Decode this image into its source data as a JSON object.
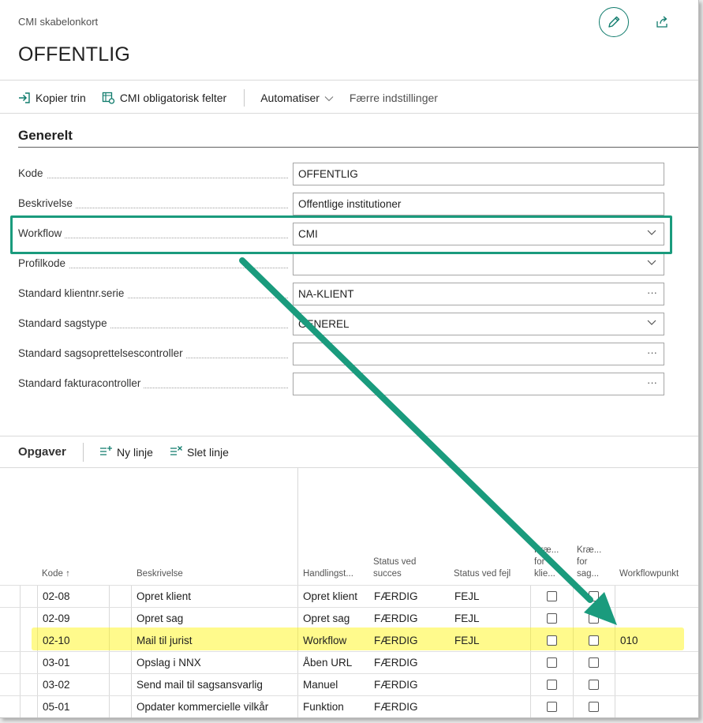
{
  "header": {
    "breadcrumb": "CMI skabelonkort",
    "title": "OFFENTLIG"
  },
  "actions": {
    "kopier": "Kopier trin",
    "obligatorisk": "CMI obligatorisk felter",
    "automatiser": "Automatiser",
    "faerre": "Færre indstillinger"
  },
  "general": {
    "title": "Generelt",
    "fields": [
      {
        "label": "Kode",
        "value": "OFFENTLIG",
        "suffix": ""
      },
      {
        "label": "Beskrivelse",
        "value": "Offentlige institutioner",
        "suffix": ""
      },
      {
        "label": "Workflow",
        "value": "CMI",
        "suffix": "chevron"
      },
      {
        "label": "Profilkode",
        "value": "",
        "suffix": "chevron"
      },
      {
        "label": "Standard klientnr.serie",
        "value": "NA-KLIENT",
        "suffix": "dots"
      },
      {
        "label": "Standard sagstype",
        "value": "GENEREL",
        "suffix": "chevron"
      },
      {
        "label": "Standard sagsoprettelsescontroller",
        "value": "",
        "suffix": "dots"
      },
      {
        "label": "Standard fakturacontroller",
        "value": "",
        "suffix": "dots"
      }
    ]
  },
  "tasks": {
    "title": "Opgaver",
    "new_line": "Ny linje",
    "delete_line": "Slet linje",
    "columns": {
      "kode": "Kode",
      "sort_indicator": "↑",
      "beskrivelse": "Beskrivelse",
      "handling": "Handlingst...",
      "status_succes_1": "Status ved",
      "status_succes_2": "succes",
      "status_fejl": "Status ved fejl",
      "kraev_klient_1": "Kræ...",
      "kraev_klient_2": "for",
      "kraev_klient_3": "klie...",
      "kraev_sag_1": "Kræ...",
      "kraev_sag_2": "for",
      "kraev_sag_3": "sag...",
      "workflowpunkt": "Workflowpunkt"
    },
    "rows": [
      {
        "kode": "02-08",
        "beskrivelse": "Opret klient",
        "handling": "Opret klient",
        "succes": "FÆRDIG",
        "fejl": "FEJL",
        "workflowpunkt": ""
      },
      {
        "kode": "02-09",
        "beskrivelse": "Opret sag",
        "handling": "Opret sag",
        "succes": "FÆRDIG",
        "fejl": "FEJL",
        "workflowpunkt": ""
      },
      {
        "kode": "02-10",
        "beskrivelse": "Mail til jurist",
        "handling": "Workflow",
        "succes": "FÆRDIG",
        "fejl": "FEJL",
        "workflowpunkt": "010"
      },
      {
        "kode": "03-01",
        "beskrivelse": "Opslag i NNX",
        "handling": "Åben URL",
        "succes": "FÆRDIG",
        "fejl": "",
        "workflowpunkt": ""
      },
      {
        "kode": "03-02",
        "beskrivelse": "Send mail til sagsansvarlig",
        "handling": "Manuel",
        "succes": "FÆRDIG",
        "fejl": "",
        "workflowpunkt": ""
      },
      {
        "kode": "05-01",
        "beskrivelse": "Opdater kommercielle vilkår",
        "handling": "Funktion",
        "succes": "FÆRDIG",
        "fejl": "",
        "workflowpunkt": ""
      }
    ]
  },
  "colors": {
    "accent": "#0f7b6c",
    "annotation_green": "#1a9b7d",
    "highlight_yellow": "#fff400"
  }
}
